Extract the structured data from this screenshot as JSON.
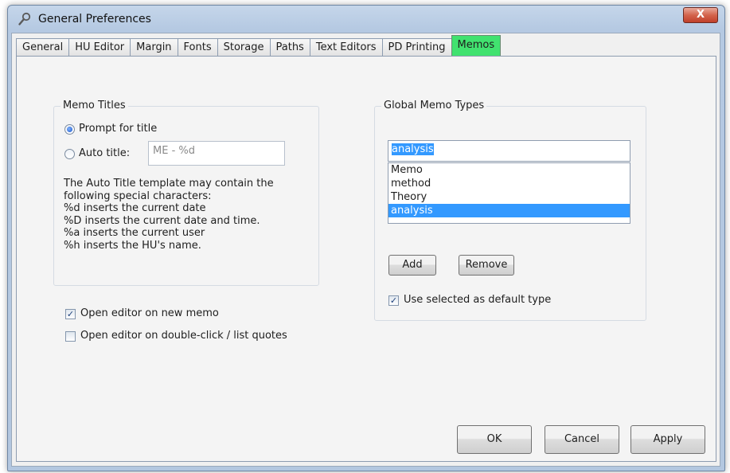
{
  "window": {
    "title": "General Preferences",
    "close_label": "X",
    "icon": "wrench-magnifier-icon"
  },
  "tabs": [
    {
      "label": "General",
      "active": false
    },
    {
      "label": "HU Editor",
      "active": false
    },
    {
      "label": "Margin",
      "active": false
    },
    {
      "label": "Fonts",
      "active": false
    },
    {
      "label": "Storage",
      "active": false
    },
    {
      "label": "Paths",
      "active": false
    },
    {
      "label": "Text Editors",
      "active": false
    },
    {
      "label": "PD Printing",
      "active": false
    },
    {
      "label": "Memos",
      "active": true
    }
  ],
  "memo_titles": {
    "group_label": "Memo Titles",
    "prompt_label": "Prompt for title",
    "prompt_selected": true,
    "auto_label": "Auto title:",
    "auto_selected": false,
    "auto_value": "ME - %d",
    "help_lines": [
      "The Auto Title template may contain the",
      "following special characters:",
      "%d inserts the current date",
      "%D inserts the current date and time.",
      "%a inserts the current user",
      "%h inserts the HU's name."
    ]
  },
  "options": {
    "open_new_label": "Open editor on new memo",
    "open_new_checked": true,
    "open_dbl_label": "Open editor on double-click / list quotes",
    "open_dbl_checked": false
  },
  "global_types": {
    "group_label": "Global Memo Types",
    "input_value": "analysis",
    "items": [
      "Memo",
      "method",
      "Theory",
      "analysis"
    ],
    "selected_index": 3,
    "add_label": "Add",
    "remove_label": "Remove",
    "default_label": "Use selected as default type",
    "default_checked": true
  },
  "buttons": {
    "ok": "OK",
    "cancel": "Cancel",
    "apply": "Apply"
  },
  "colors": {
    "active_tab": "#41e26f",
    "selection": "#3399ff",
    "close_button": "#c0402a"
  }
}
